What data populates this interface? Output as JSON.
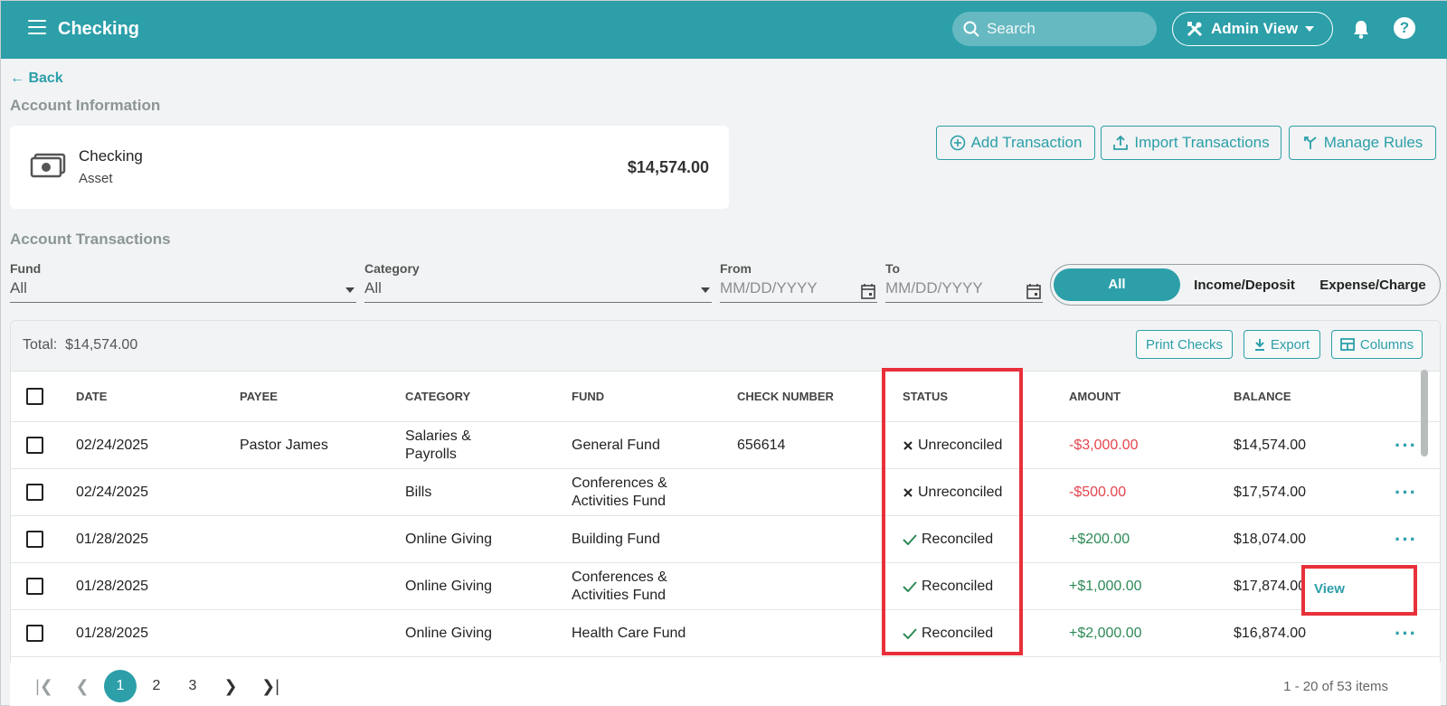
{
  "header": {
    "title": "Checking",
    "search_placeholder": "Search",
    "admin_label": "Admin View"
  },
  "back_label": "Back",
  "account_info": {
    "section_title": "Account Information",
    "name": "Checking",
    "type": "Asset",
    "balance": "$14,574.00"
  },
  "actions": {
    "add": "Add Transaction",
    "import": "Import Transactions",
    "rules": "Manage Rules"
  },
  "transactions": {
    "section_title": "Account Transactions",
    "filters": {
      "fund_label": "Fund",
      "fund_value": "All",
      "category_label": "Category",
      "category_value": "All",
      "from_label": "From",
      "from_placeholder": "MM/DD/YYYY",
      "to_label": "To",
      "to_placeholder": "MM/DD/YYYY"
    },
    "type_toggle": [
      "All",
      "Income/Deposit",
      "Expense/Charge"
    ],
    "total_label": "Total:",
    "total_value": "$14,574.00",
    "toolbar": {
      "print": "Print Checks",
      "export": "Export",
      "columns": "Columns"
    },
    "columns": [
      "DATE",
      "PAYEE",
      "CATEGORY",
      "FUND",
      "CHECK NUMBER",
      "STATUS",
      "AMOUNT",
      "BALANCE"
    ],
    "rows": [
      {
        "date": "02/24/2025",
        "payee": "Pastor James",
        "category": "Salaries & Payrolls",
        "fund": "General Fund",
        "check": "656614",
        "status": "Unreconciled",
        "amount": "-$3,000.00",
        "balance": "$14,574.00"
      },
      {
        "date": "02/24/2025",
        "payee": "",
        "category": "Bills",
        "fund": "Conferences & Activities Fund",
        "check": "",
        "status": "Unreconciled",
        "amount": "-$500.00",
        "balance": "$17,574.00"
      },
      {
        "date": "01/28/2025",
        "payee": "",
        "category": "Online Giving",
        "fund": "Building Fund",
        "check": "",
        "status": "Reconciled",
        "amount": "+$200.00",
        "balance": "$18,074.00"
      },
      {
        "date": "01/28/2025",
        "payee": "",
        "category": "Online Giving",
        "fund": "Conferences & Activities Fund",
        "check": "",
        "status": "Reconciled",
        "amount": "+$1,000.00",
        "balance": "$17,874.00"
      },
      {
        "date": "01/28/2025",
        "payee": "",
        "category": "Online Giving",
        "fund": "Health Care Fund",
        "check": "",
        "status": "Reconciled",
        "amount": "+$2,000.00",
        "balance": "$16,874.00"
      }
    ],
    "row_menu_item": "View"
  },
  "pagination": {
    "pages": [
      "1",
      "2",
      "3"
    ],
    "current": "1",
    "summary": "1 - 20 of 53 items"
  },
  "colors": {
    "accent": "#2c9fa9",
    "negative": "#e4454e",
    "positive": "#2e8a57",
    "highlight": "#e8303a"
  }
}
